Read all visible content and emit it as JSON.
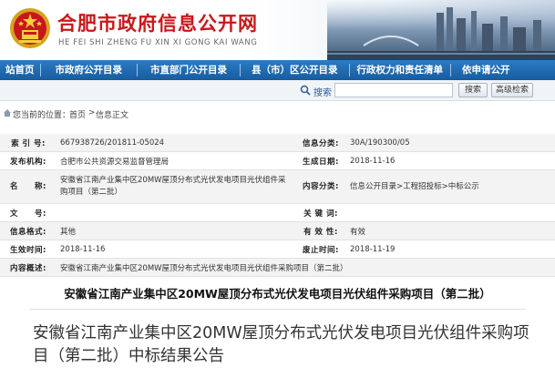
{
  "header": {
    "site_title": "合肥市政府信息公开网",
    "site_subtitle": "HE FEI SHI ZHENG FU XIN XI GONG KAI WANG",
    "emblem_icon": "national-emblem-icon",
    "brand_color": "#c8171b"
  },
  "nav": {
    "items": [
      {
        "label": "站首页"
      },
      {
        "label": "市政府公开目录"
      },
      {
        "label": "市直部门公开目录"
      },
      {
        "label": "县（市）区公开目录"
      },
      {
        "label": "行政权力和责任清单"
      },
      {
        "label": "依申请公开"
      }
    ],
    "color": "#1f69b0"
  },
  "search": {
    "label": "搜索",
    "placeholder": "",
    "search_button": "搜索",
    "advanced_button": "高级检索"
  },
  "breadcrumb": {
    "prefix": "您当前的位置：",
    "home": "首页",
    "sep": ">",
    "current": "信息正文"
  },
  "info": {
    "rows": [
      {
        "l1": "索 引 号:",
        "v1": "667938726/201811-05024",
        "l2": "信息分类:",
        "v2": "30A/190300/05"
      },
      {
        "l1": "发布机构:",
        "v1": "合肥市公共资源交易监督管理局",
        "l2": "生成日期:",
        "v2": "2018-11-16"
      },
      {
        "l1": "名　　称:",
        "v1": "安徽省江南产业集中区20MW屋顶分布式光伏发电项目光伏组件采购项目（第二批）",
        "l2": "内容分类:",
        "v2": "信息公开目录>工程招投标>中标公示"
      },
      {
        "l1": "文　　号:",
        "v1": "",
        "l2": "关 键 词:",
        "v2": ""
      },
      {
        "l1": "信息格式:",
        "v1": "其他",
        "l2": "有 效 性:",
        "v2": "有效"
      },
      {
        "l1": "生效时间:",
        "v1": "2018-11-16",
        "l2": "废止时间:",
        "v2": "2018-11-19"
      }
    ],
    "summary_label": "内容概述:",
    "summary": "安徽省江南产业集中区20MW屋顶分布式光伏发电项目光伏组件采购项目（第二批）"
  },
  "doc_title": "安徽省江南产业集中区20MW屋顶分布式光伏发电项目光伏组件采购项目（第二批）",
  "sub_title": "安徽省江南产业集中区20MW屋顶分布式光伏发电项目光伏组件采购项目（第二批）中标结果公告"
}
